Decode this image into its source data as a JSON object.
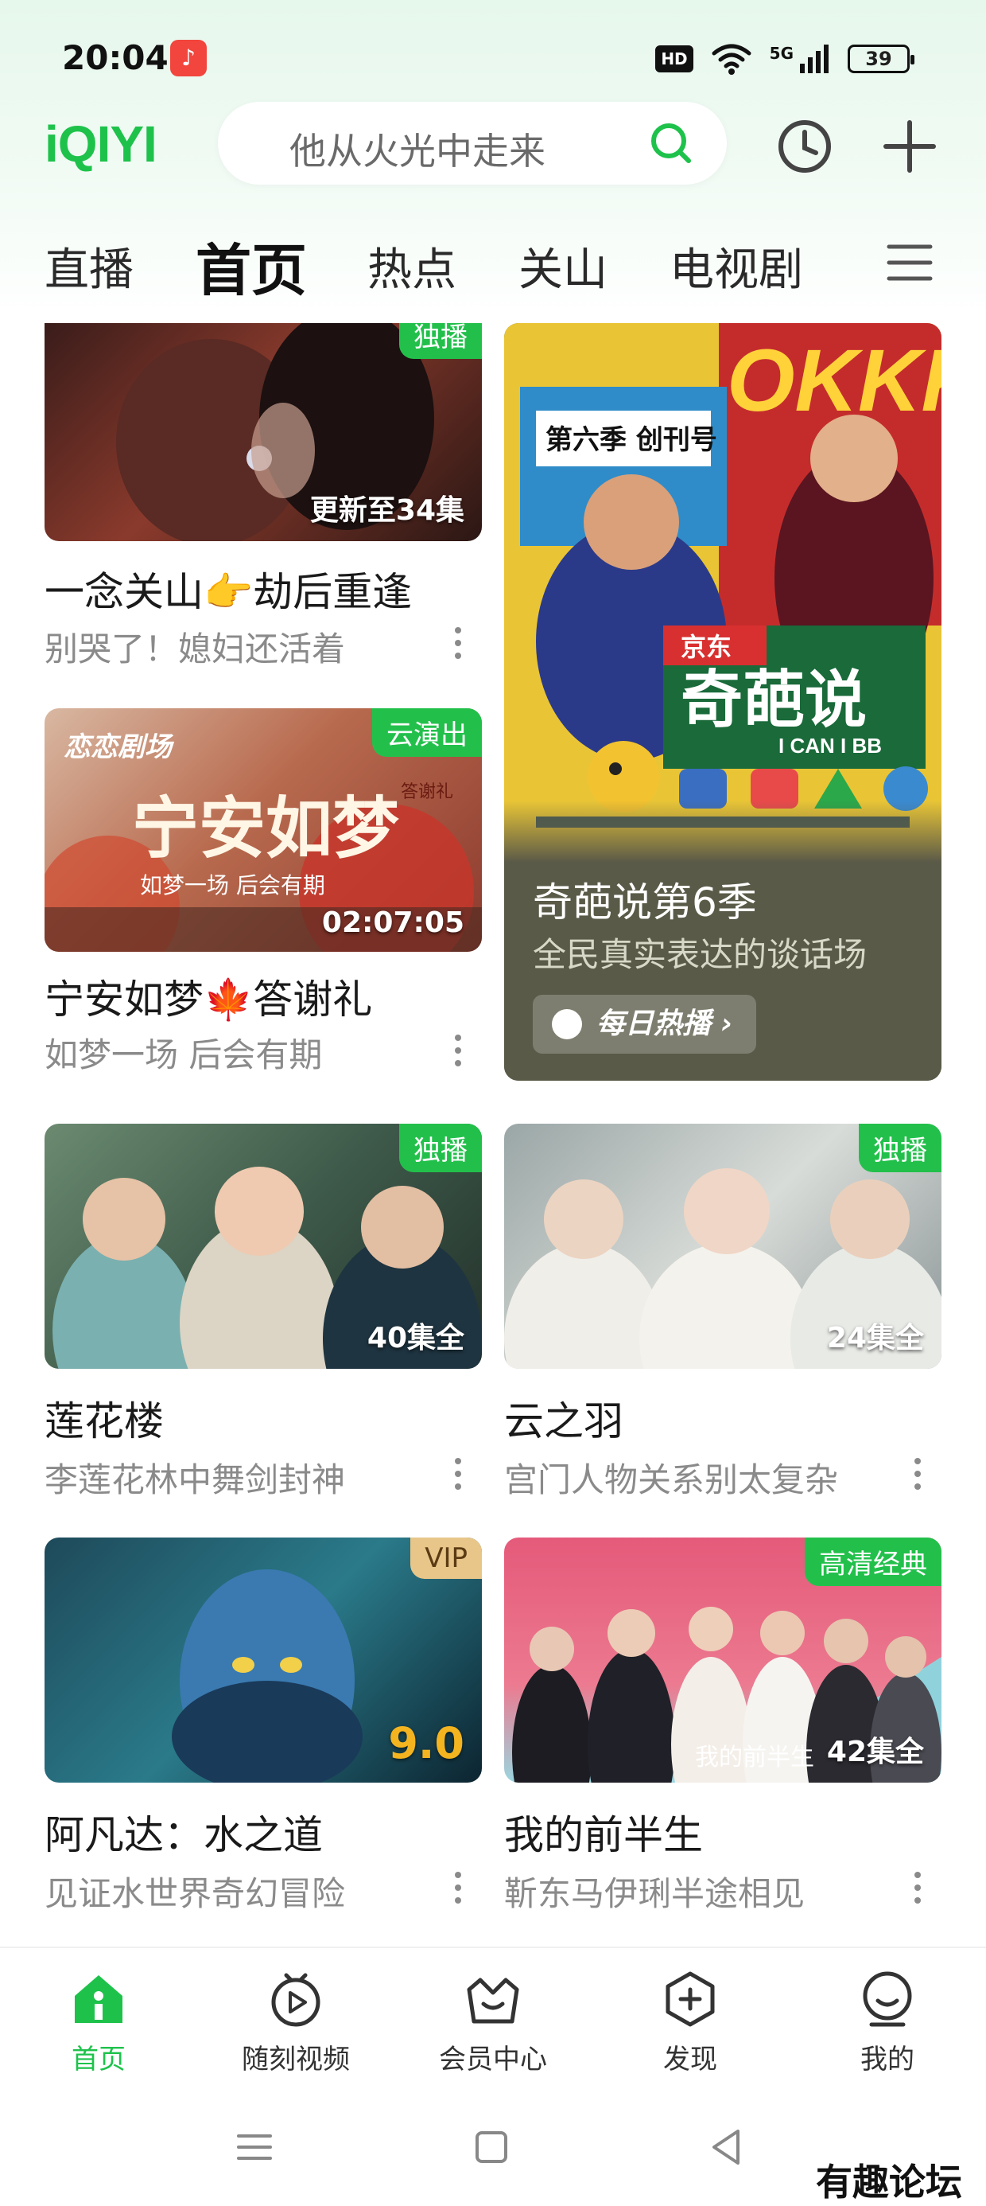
{
  "status_bar": {
    "time": "20:04",
    "app_icon": "music-note-icon",
    "hd": "HD",
    "network": "5G",
    "battery": "39"
  },
  "header": {
    "logo": "iQIYI",
    "search_placeholder": "他从火光中走来",
    "brand_color": "#1ec24b"
  },
  "tabs": [
    {
      "label": "直播"
    },
    {
      "label": "首页",
      "active": true
    },
    {
      "label": "热点"
    },
    {
      "label": "关山"
    },
    {
      "label": "电视剧"
    }
  ],
  "feed": {
    "cards": [
      {
        "badge": "独播",
        "overlay": "更新至34集",
        "title": "一念关山👉劫后重逢",
        "subtitle": "别哭了！媳妇还活着"
      },
      {
        "badge": "云演出",
        "overlay": "02:07:05",
        "title": "宁安如梦🍁答谢礼",
        "subtitle": "如梦一场 后会有期",
        "thumb_logo": "恋恋剧场",
        "thumb_title": "宁安如梦",
        "thumb_tagline": "如梦一场 后会有期",
        "thumb_side": "答谢礼"
      },
      {
        "badge": "独播",
        "overlay": "40集全",
        "title": "莲花楼",
        "subtitle": "李莲花林中舞剑封神"
      },
      {
        "badge": "独播",
        "overlay": "24集全",
        "title": "云之羽",
        "subtitle": "宫门人物关系别太复杂"
      },
      {
        "badge": "VIP",
        "score": "9.0",
        "title": "阿凡达：水之道",
        "subtitle": "见证水世界奇幻冒险"
      },
      {
        "badge": "高清经典",
        "overlay": "42集全",
        "title": "我的前半生",
        "subtitle": "靳东马伊琍半途相见",
        "thumb_text": "我的前半生"
      }
    ],
    "promo": {
      "title": "奇葩说第6季",
      "subtitle": "全民真实表达的谈话场",
      "button": "每日热播",
      "poster_season": "第六季 创刊号",
      "poster_brand": "京东",
      "poster_show": "奇葩说",
      "poster_english": "I CAN I BB",
      "poster_corner": "OKKK"
    }
  },
  "bottom_nav": [
    {
      "label": "首页",
      "icon": "home-icon",
      "active": true
    },
    {
      "label": "随刻视频",
      "icon": "video-icon"
    },
    {
      "label": "会员中心",
      "icon": "vip-crown-icon"
    },
    {
      "label": "发现",
      "icon": "discover-icon"
    },
    {
      "label": "我的",
      "icon": "profile-icon"
    }
  ],
  "watermark": "有趣论坛"
}
